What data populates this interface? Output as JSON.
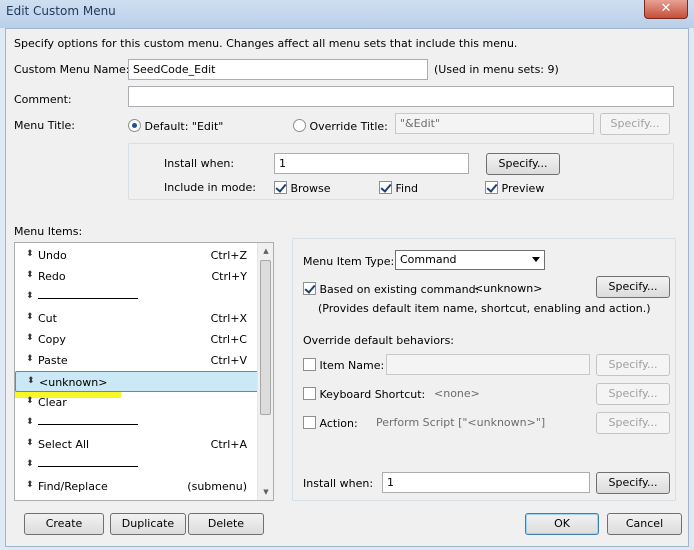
{
  "window": {
    "title": "Edit Custom Menu",
    "close_glyph": "✕"
  },
  "intro": "Specify options for this custom menu. Changes affect all menu sets that include this menu.",
  "menu_name": {
    "label": "Custom Menu Name:",
    "value": "SeedCode_Edit",
    "used_in": "(Used in menu sets: 9)"
  },
  "comment": {
    "label": "Comment:",
    "value": ""
  },
  "menu_title": {
    "label": "Menu Title:",
    "default_option": "Default: \"Edit\"",
    "override_option": "Override Title:",
    "override_value": "\"&Edit\"",
    "specify": "Specify..."
  },
  "install_box": {
    "install_when_label": "Install when:",
    "install_when_value": "1",
    "specify": "Specify...",
    "include_label": "Include in mode:",
    "modes": [
      "Browse",
      "Find",
      "Preview"
    ]
  },
  "menu_items": {
    "label": "Menu Items:",
    "grip_glyph": "⬍",
    "separator_text": "———————————",
    "rows": [
      {
        "label": "Undo",
        "shortcut": "Ctrl+Z"
      },
      {
        "label": "Redo",
        "shortcut": "Ctrl+Y"
      },
      {
        "separator": true
      },
      {
        "label": "Cut",
        "shortcut": "Ctrl+X"
      },
      {
        "label": "Copy",
        "shortcut": "Ctrl+C"
      },
      {
        "label": "Paste",
        "shortcut": "Ctrl+V"
      },
      {
        "label": "<unknown>",
        "shortcut": "",
        "selected": true
      },
      {
        "label": "Clear",
        "shortcut": ""
      },
      {
        "separator": true
      },
      {
        "label": "Select All",
        "shortcut": "Ctrl+A"
      },
      {
        "separator": true
      },
      {
        "label": "Find/Replace",
        "shortcut": "(submenu)"
      }
    ]
  },
  "item_panel": {
    "type_label": "Menu Item Type:",
    "type_value": "Command",
    "based_on_label": "Based on existing command:",
    "based_on_value": "<unknown>",
    "based_on_specify": "Specify...",
    "provides_note": "(Provides default item name, shortcut, enabling and action.)",
    "override_label": "Override default behaviors:",
    "item_name_label": "Item Name:",
    "item_name_specify": "Specify...",
    "keyboard_label": "Keyboard Shortcut:",
    "keyboard_value": "<none>",
    "keyboard_specify": "Specify...",
    "action_label": "Action:",
    "action_value": "Perform Script [\"<unknown>\"]",
    "action_specify": "Specify...",
    "install_when_label": "Install when:",
    "install_when_value": "1",
    "install_specify": "Specify..."
  },
  "buttons": {
    "create": "Create",
    "duplicate": "Duplicate",
    "delete": "Delete",
    "ok": "OK",
    "cancel": "Cancel"
  },
  "colors": {
    "highlight": "#f6f600",
    "selection": "#cbe8f6"
  }
}
